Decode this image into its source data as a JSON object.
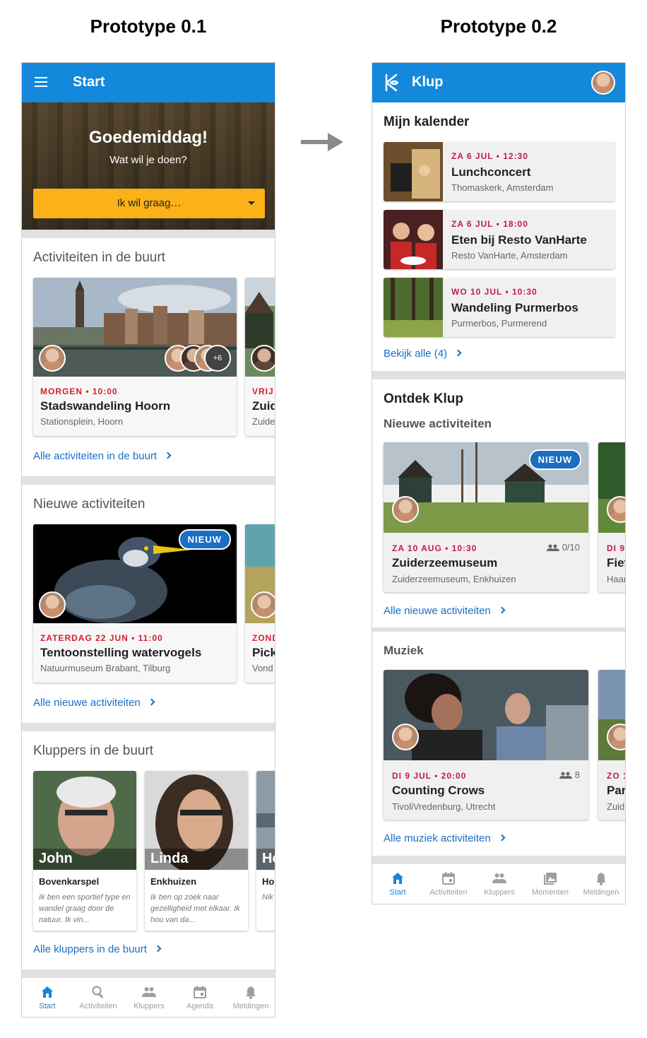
{
  "titles": {
    "left": "Prototype 0.1",
    "right": "Prototype 0.2"
  },
  "p1": {
    "appbar_title": "Start",
    "greeting": "Goedemiddag!",
    "greeting_sub": "Wat wil je doen?",
    "select_label": "Ik wil graag…",
    "nearby": {
      "title": "Activiteiten in de buurt",
      "card1": {
        "date": "MORGEN • 10:00",
        "name": "Stadswandeling Hoorn",
        "place": "Stationsplein, Hoorn",
        "more": "+6"
      },
      "card2": {
        "date": "VRIJ",
        "name": "Zuid",
        "place": "Zuide"
      },
      "link": "Alle activiteiten in de buurt"
    },
    "new": {
      "title": "Nieuwe activiteiten",
      "badge": "NIEUW",
      "card1": {
        "date": "ZATERDAG 22 JUN • 11:00",
        "name": "Tentoonstelling watervogels",
        "place": "Natuurmuseum Brabant, Tilburg"
      },
      "card2": {
        "date": "ZOND",
        "name": "Pick",
        "place": "Vond"
      },
      "link": "Alle nieuwe activiteiten"
    },
    "kluppers": {
      "title": "Kluppers in de buurt",
      "items": [
        {
          "name": "John",
          "town": "Bovenkarspel",
          "bio": "Ik ben een sportief type en wandel graag door de natuur. Ik vin..."
        },
        {
          "name": "Linda",
          "town": "Enkhuizen",
          "bio": "Ik ben op zoek naar gezelligheid met elkaar. Ik hou van da..."
        },
        {
          "name": "He",
          "town": "Ho",
          "bio": "Nik"
        }
      ],
      "link": "Alle kluppers in de buurt"
    },
    "nav": [
      "Start",
      "Activiteiten",
      "Kluppers",
      "Agenda",
      "Meldingen"
    ]
  },
  "p2": {
    "appbar_title": "Klup",
    "calendar": {
      "title": "Mijn kalender",
      "items": [
        {
          "date": "ZA 6 JUL • 12:30",
          "name": "Lunchconcert",
          "place": "Thomaskerk, Amsterdam"
        },
        {
          "date": "ZA 6 JUL • 18:00",
          "name": "Eten bij Resto VanHarte",
          "place": "Resto VanHarte, Amsterdam"
        },
        {
          "date": "WO 10 JUL • 10:30",
          "name": "Wandeling Purmerbos",
          "place": "Purmerbos, Purmerend"
        }
      ],
      "link": "Bekijk alle (4)"
    },
    "discover": {
      "title": "Ontdek Klup",
      "subtitle": "Nieuwe activiteiten",
      "badge": "NIEUW",
      "card1": {
        "date": "ZA 10 AUG • 10:30",
        "count": "0/10",
        "name": "Zuiderzeemuseum",
        "place": "Zuiderzeemuseum, Enkhuizen"
      },
      "card2": {
        "date": "DI 9",
        "name": "Fiet",
        "place": "Haar"
      },
      "link": "Alle nieuwe activiteiten"
    },
    "music": {
      "title": "Muziek",
      "card1": {
        "date": "DI 9 JUL • 20:00",
        "count": "8",
        "name": "Counting Crows",
        "place": "TivoliVredenburg, Utrecht"
      },
      "card2": {
        "date": "ZO 1",
        "name": "Par",
        "place": "Zuid"
      },
      "link": "Alle muziek activiteiten"
    },
    "nav": [
      "Start",
      "Activiteiten",
      "Kluppers",
      "Momenten",
      "Meldingen"
    ]
  },
  "colors": {
    "appbar": "#1488db",
    "accent_yellow": "#fbb117",
    "date_red": "#d0202f",
    "date_magenta": "#c2185b",
    "link_blue": "#1a6fc2"
  },
  "icons": {
    "menu": "hamburger-icon",
    "logo": "klup-logo-icon",
    "arrow": "right-arrow-icon",
    "chevron": "chevron-right-icon",
    "people": "people-icon"
  }
}
